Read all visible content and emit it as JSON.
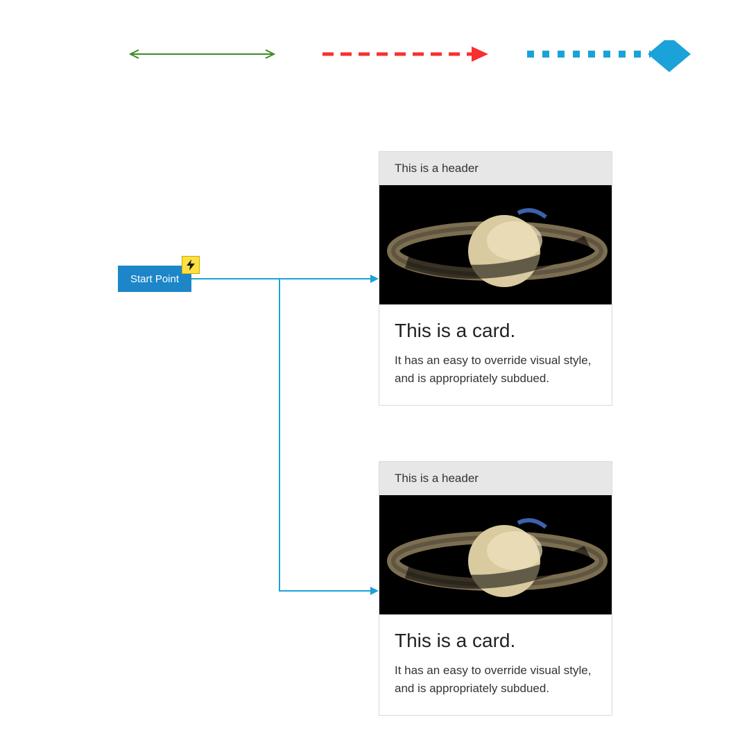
{
  "legend": {
    "line1": {
      "style": "solid-reverse-arrows",
      "color": "#3d8c1f"
    },
    "line2": {
      "style": "dashed-arrow",
      "color": "#f92f2f"
    },
    "line3": {
      "style": "dotted-diamond",
      "color": "#1ba2d8"
    }
  },
  "start": {
    "label": "Start Point",
    "badge": "lightning-bolt-icon"
  },
  "connectors": {
    "color": "#1ba2d8"
  },
  "cards": [
    {
      "header": "This is a header",
      "image_alt": "Saturn",
      "title": "This is a card.",
      "body": "It has an easy to override visual style, and is appropriately subdued."
    },
    {
      "header": "This is a header",
      "image_alt": "Saturn",
      "title": "This is a card.",
      "body": "It has an easy to override visual style, and is appropriately subdued."
    }
  ]
}
